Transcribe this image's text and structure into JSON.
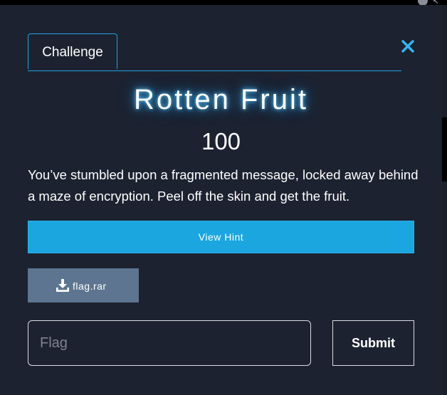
{
  "modal": {
    "tab_label": "Challenge",
    "close_icon": "close-icon",
    "title": "Rotten Fruit",
    "points": "100",
    "description": "You’ve stumbled upon a fragmented message, locked away behind a maze of encryption. Peel off the skin and get the fruit.",
    "hint_button_label": "View Hint",
    "file": {
      "icon": "download-icon",
      "name": "flag.rar"
    },
    "flag_input": {
      "placeholder": "Flag",
      "value": ""
    },
    "submit_label": "Submit"
  },
  "colors": {
    "accent": "#1fa2dd",
    "hint_button_bg": "#1ba6e0",
    "file_button_bg": "#5d7590",
    "modal_bg": "#1c2230",
    "title_glow": "#5fc8ff"
  }
}
